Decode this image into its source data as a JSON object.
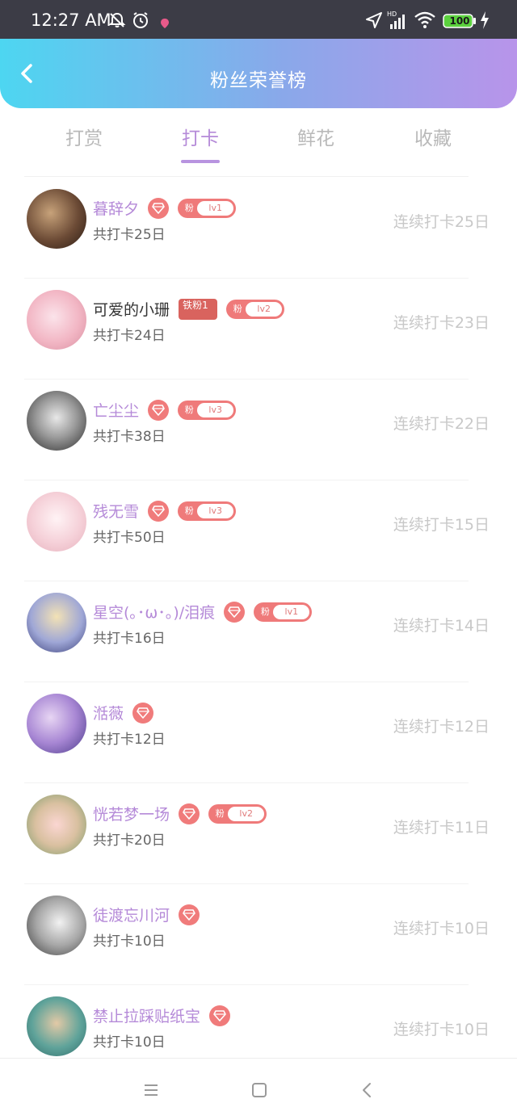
{
  "status_bar": {
    "time": "12:27 AM",
    "battery": "100",
    "network": "HD"
  },
  "header": {
    "title": "粉丝荣誉榜"
  },
  "tabs": [
    {
      "label": "打赏",
      "active": false
    },
    {
      "label": "打卡",
      "active": true
    },
    {
      "label": "鲜花",
      "active": false
    },
    {
      "label": "收藏",
      "active": false
    }
  ],
  "fan_badge_text": "粉",
  "rows": [
    {
      "name": "暮辞夕",
      "vip": true,
      "fan_level": "lv1",
      "total": "共打卡25日",
      "streak": "连续打卡25日"
    },
    {
      "name": "可爱的小珊",
      "vip": false,
      "tiefen": "铁粉1",
      "fan_level": "lv2",
      "total": "共打卡24日",
      "streak": "连续打卡23日"
    },
    {
      "name": "亡尘尘",
      "vip": true,
      "fan_level": "lv3",
      "total": "共打卡38日",
      "streak": "连续打卡22日"
    },
    {
      "name": "残无雪",
      "vip": true,
      "fan_level": "lv3",
      "total": "共打卡50日",
      "streak": "连续打卡15日"
    },
    {
      "name": "星空(｡･ω･｡)/泪痕",
      "vip": true,
      "fan_level": "lv1",
      "total": "共打卡16日",
      "streak": "连续打卡14日"
    },
    {
      "name": "湉薇",
      "vip": true,
      "fan_level": null,
      "total": "共打卡12日",
      "streak": "连续打卡12日"
    },
    {
      "name": "恍若梦一场",
      "vip": true,
      "fan_level": "lv2",
      "total": "共打卡20日",
      "streak": "连续打卡11日"
    },
    {
      "name": "徒渡忘川河",
      "vip": true,
      "fan_level": null,
      "total": "共打卡10日",
      "streak": "连续打卡10日"
    },
    {
      "name": "禁止拉踩贴纸宝",
      "vip": true,
      "fan_level": null,
      "total": "共打卡10日",
      "streak": "连续打卡10日"
    }
  ],
  "colors": {
    "accent": "#b58ad8",
    "badge": "#ef7a7a",
    "header_start": "#4dd6f1",
    "header_end": "#b894ea"
  }
}
